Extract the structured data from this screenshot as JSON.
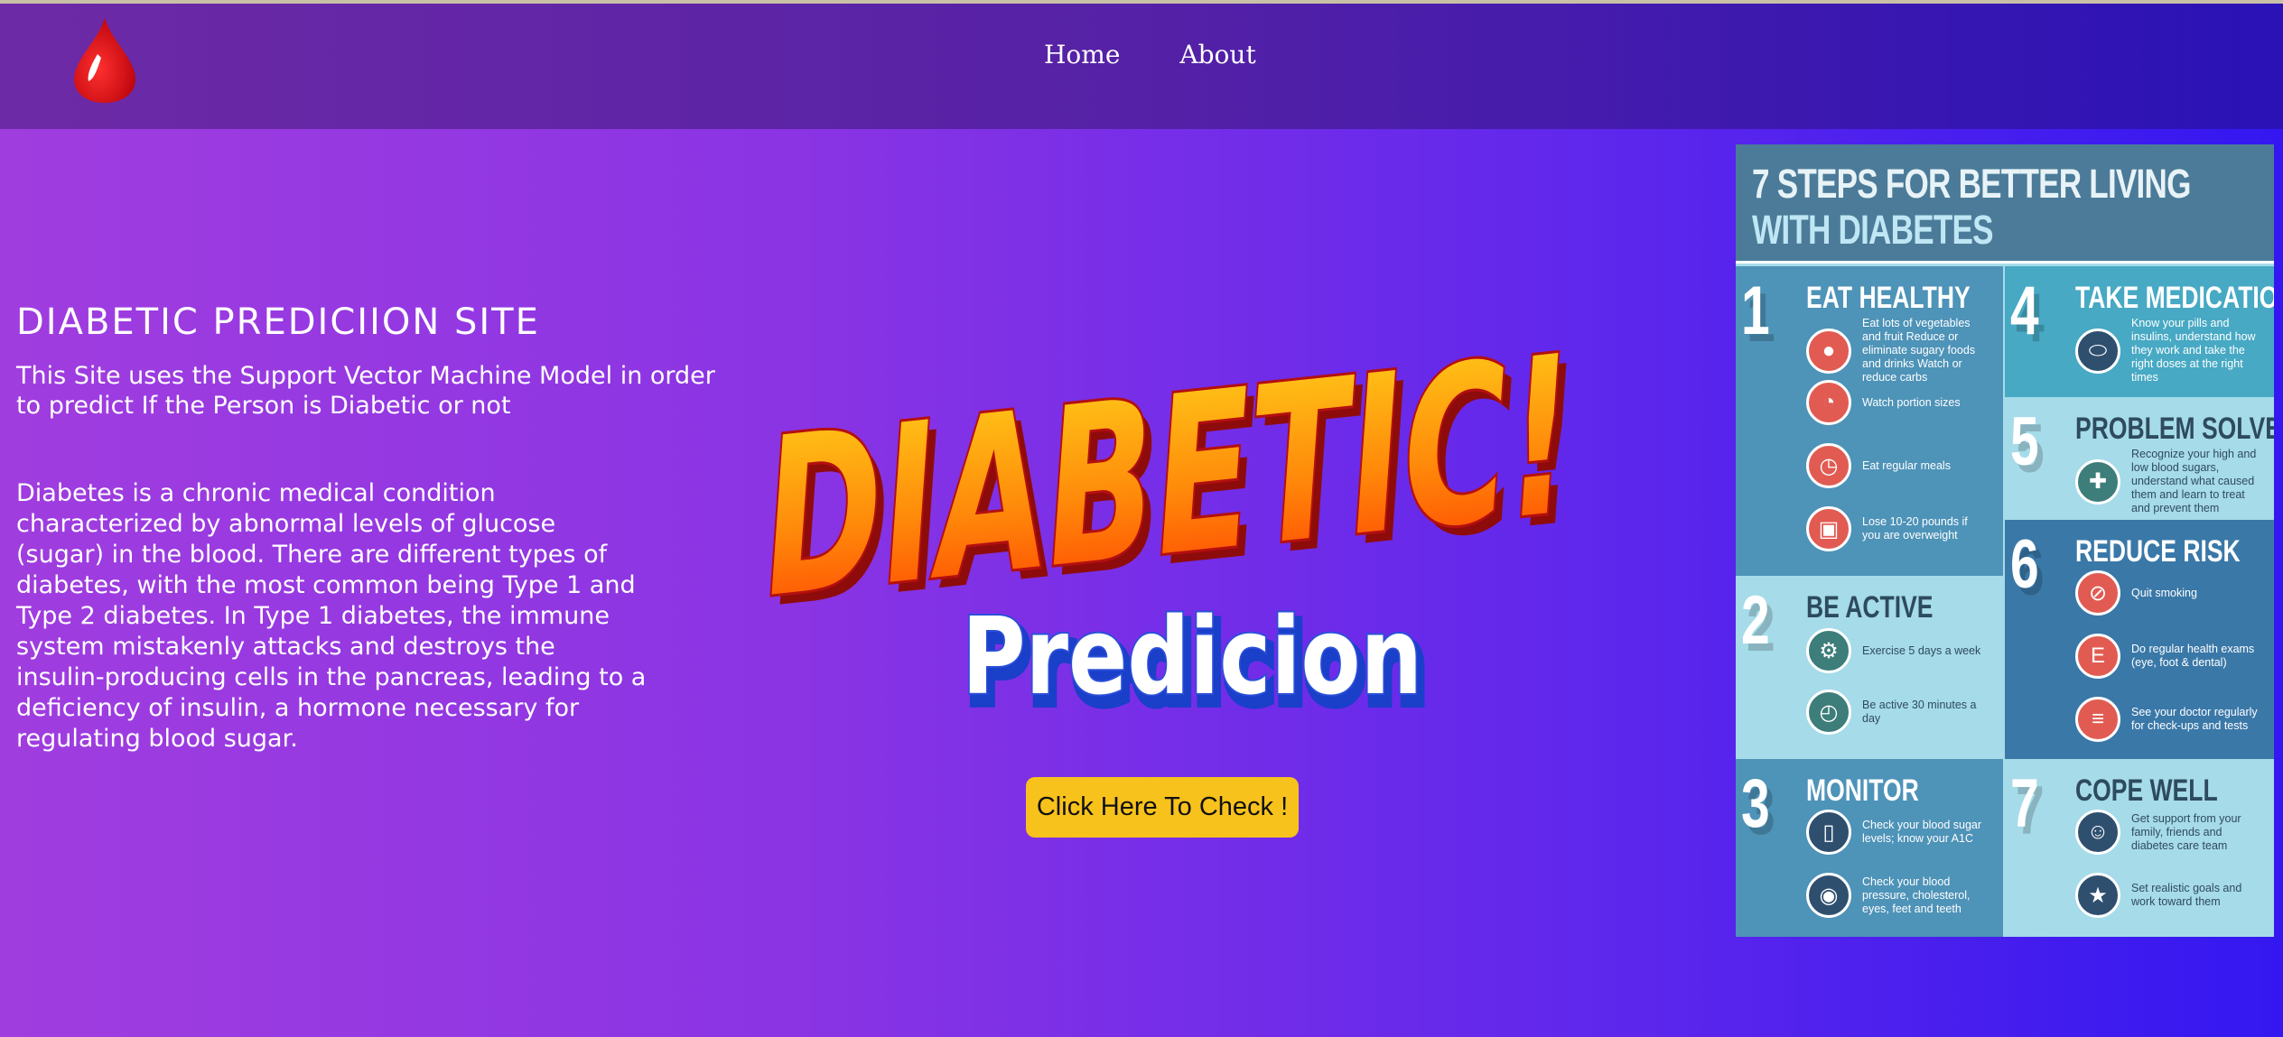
{
  "nav": {
    "home": "Home",
    "about": "About"
  },
  "main": {
    "site_title": "DIABETIC PREDICIION SITE",
    "subtitle": "This Site uses the Support Vector Machine Model in order to predict If the Person is Diabetic or not",
    "description": "Diabetes is a chronic medical condition characterized by abnormal levels of glucose (sugar) in the blood. There are different types of diabetes, with the most common being Type 1 and Type 2 diabetes. In Type 1 diabetes, the immune system mistakenly attacks and destroys the insulin-producing cells in the pancreas, leading to a deficiency of insulin, a hormone necessary for regulating blood sugar.",
    "check_button": "Click Here To Check !"
  },
  "hero": {
    "line1": "DIABETIC!",
    "line2": "Predicion"
  },
  "infographic": {
    "title_line1": "7 STEPS FOR BETTER LIVING",
    "title_line2": "WITH DIABETES",
    "steps": [
      {
        "num": "1",
        "title": "EAT HEALTHY",
        "items": [
          "Eat lots of vegetables and fruit Reduce or eliminate sugary foods and drinks Watch or reduce carbs",
          "Watch portion sizes",
          "Eat regular meals",
          "Lose 10-20 pounds if you are overweight"
        ]
      },
      {
        "num": "2",
        "title": "BE ACTIVE",
        "items": [
          "Exercise 5 days a week",
          "Be active 30 minutes a day"
        ]
      },
      {
        "num": "3",
        "title": "MONITOR",
        "items": [
          "Check your blood sugar levels; know your A1C",
          "Check your blood pressure, cholesterol, eyes, feet and teeth"
        ]
      },
      {
        "num": "4",
        "title": "TAKE MEDICATION",
        "items": [
          "Know your pills and insulins, understand how they work and take the right doses at the right times"
        ]
      },
      {
        "num": "5",
        "title": "PROBLEM SOLVE",
        "items": [
          "Recognize your high and low blood sugars, understand what caused them and learn to treat and prevent them"
        ]
      },
      {
        "num": "6",
        "title": "REDUCE RISK",
        "items": [
          "Quit smoking",
          "Do regular health exams (eye, foot & dental)",
          "See your doctor regularly for check-ups and tests"
        ]
      },
      {
        "num": "7",
        "title": "COPE WELL",
        "items": [
          "Get support from your family, friends and diabetes care team",
          "Set realistic goals and work toward them"
        ]
      }
    ]
  },
  "colors": {
    "button": "#f8c21c",
    "blood_drop": "#d60f14"
  }
}
